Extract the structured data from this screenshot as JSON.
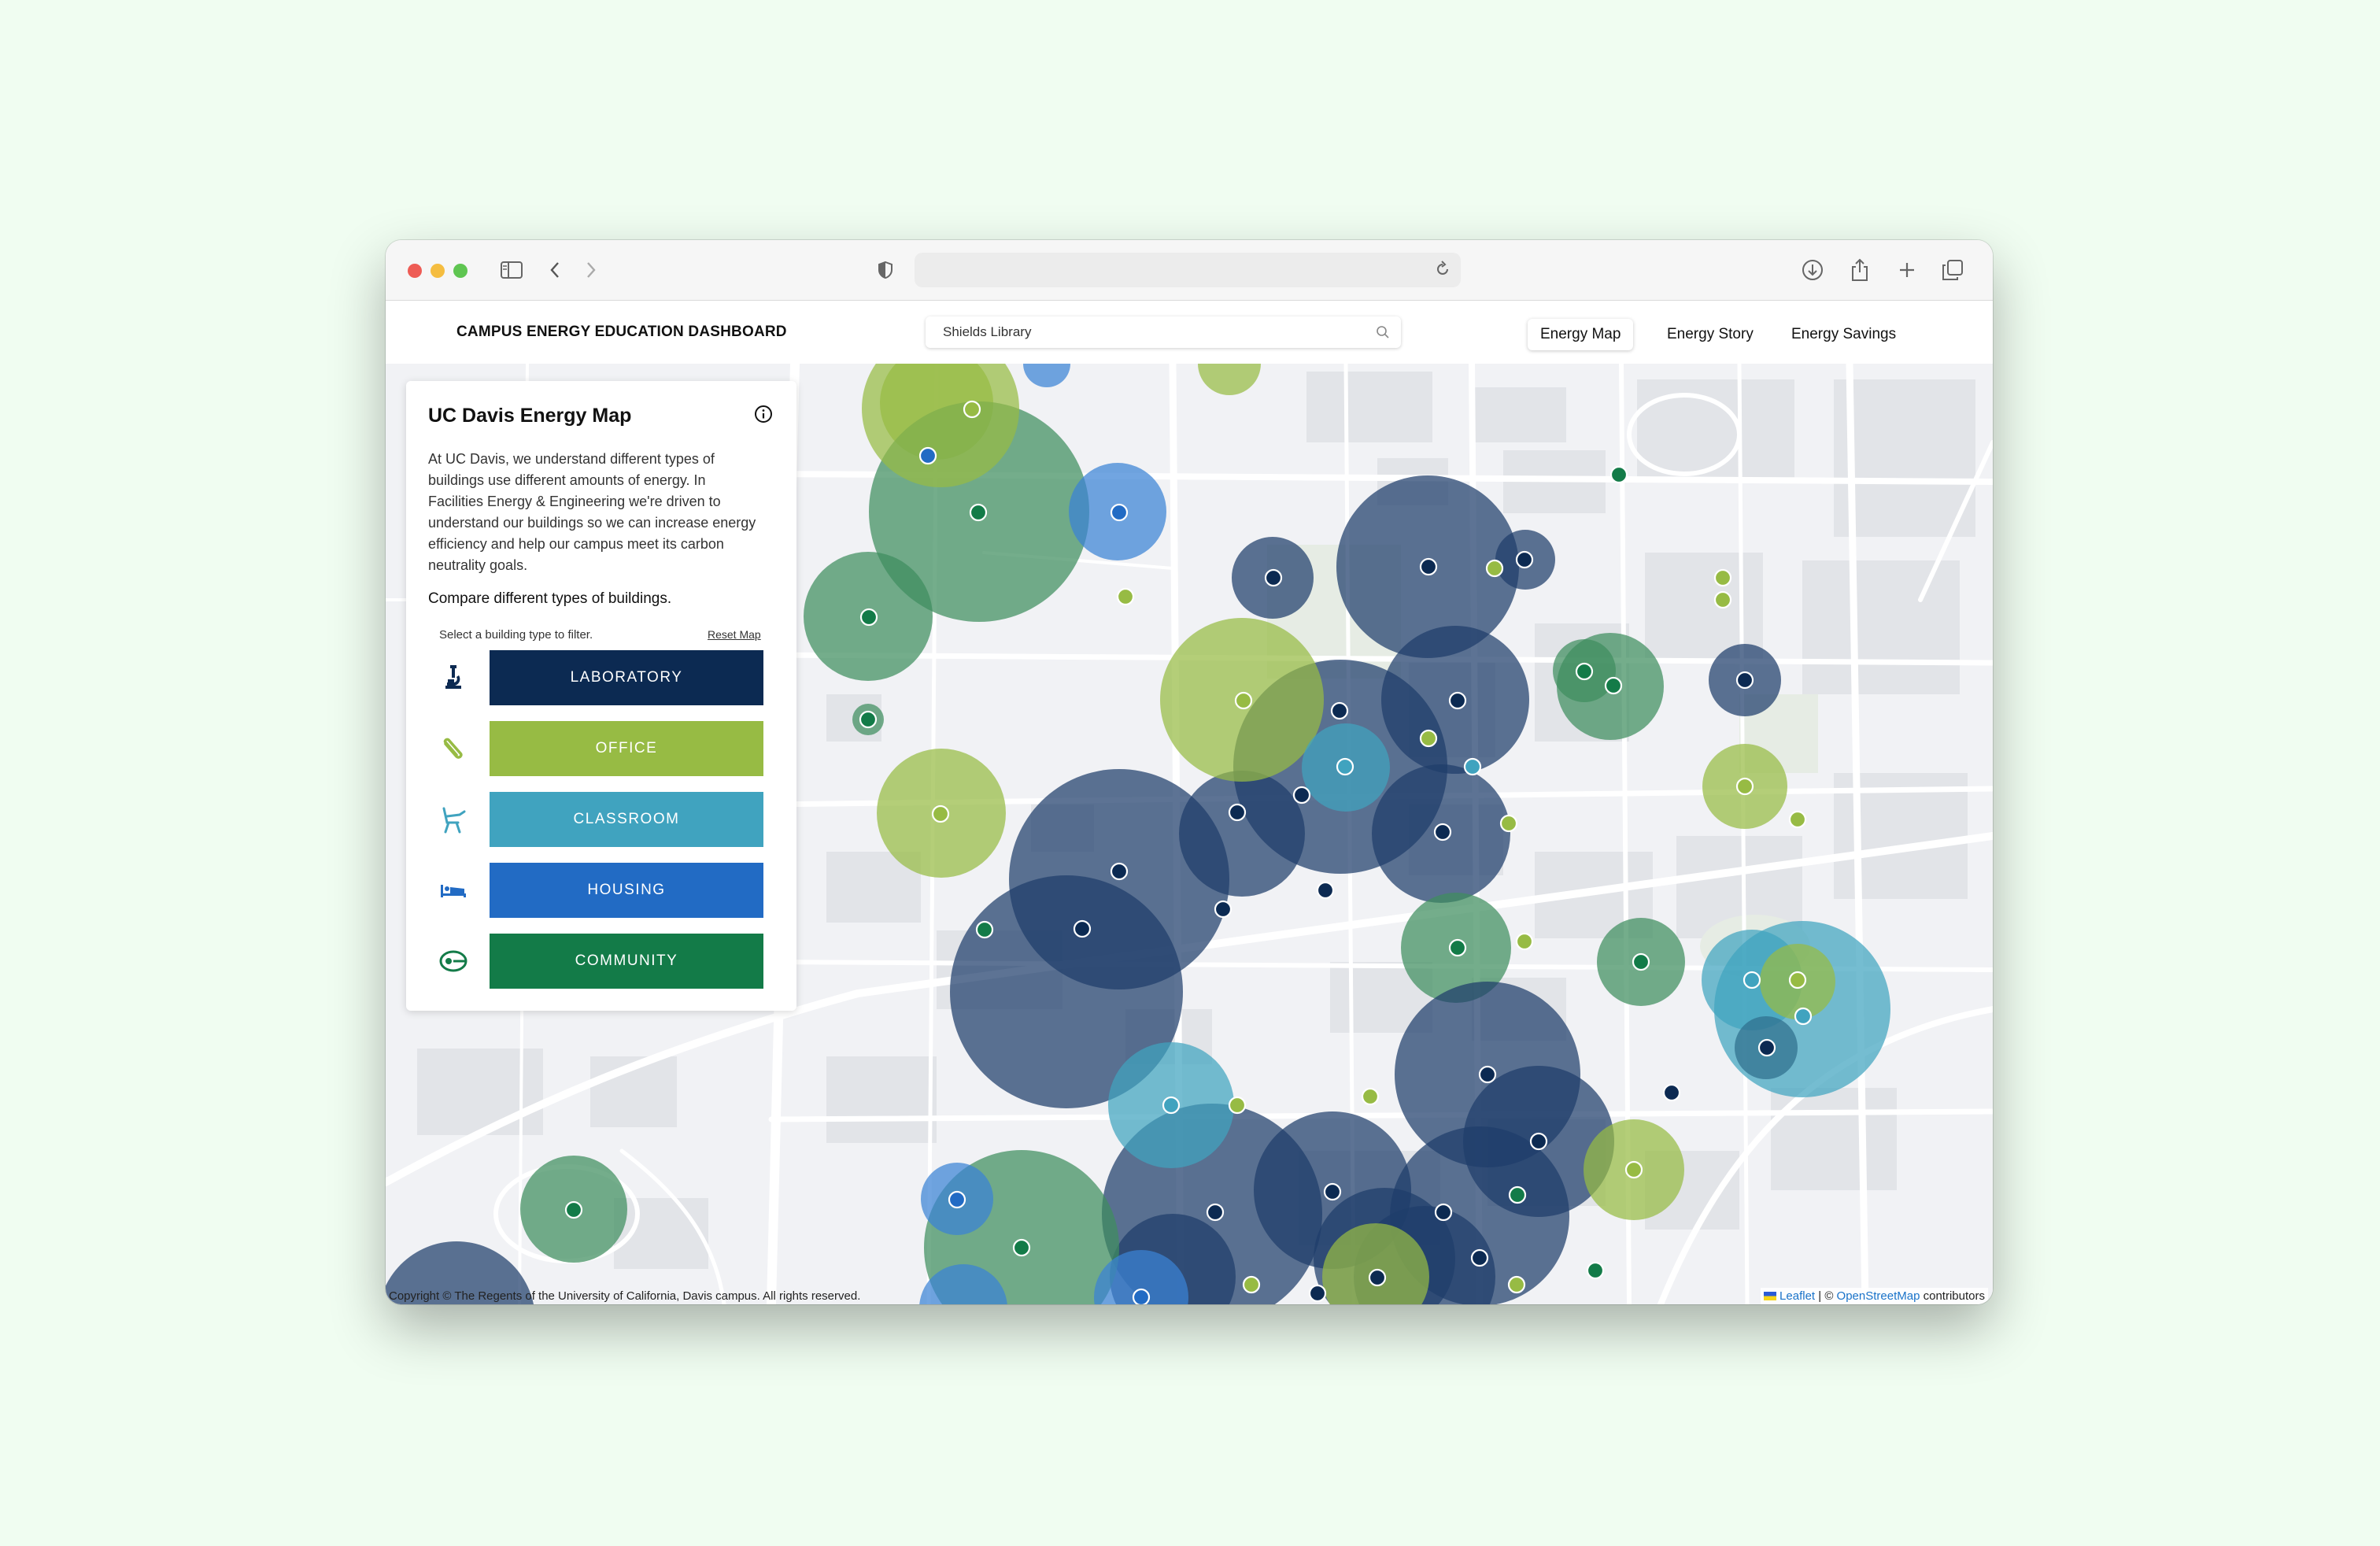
{
  "browser": {
    "address_text": "",
    "traffic_lights": [
      "#ee5c55",
      "#f5bd40",
      "#5fc551"
    ]
  },
  "app": {
    "title": "CAMPUS ENERGY EDUCATION DASHBOARD",
    "search_value": "Shields Library",
    "nav": [
      "Energy Map",
      "Energy Story",
      "Energy Savings"
    ],
    "active_nav": "Energy Map"
  },
  "panel": {
    "title": "UC Davis Energy Map",
    "description": "At UC Davis, we understand different types of buildings use different amounts of energy. In Facilities Energy & Engineering we're driven to understand our buildings so we can increase energy efficiency and help our campus meet its carbon neutrality goals.",
    "compare": "Compare different types of buildings.",
    "hint": "Select a building type to filter.",
    "reset": "Reset Map",
    "filters": [
      {
        "label": "LABORATORY",
        "color": "#0c2a52",
        "icon": "microscope-icon"
      },
      {
        "label": "OFFICE",
        "color": "#97bb44",
        "icon": "paperclip-icon"
      },
      {
        "label": "CLASSROOM",
        "color": "#40a3bf",
        "icon": "desk-chair-icon"
      },
      {
        "label": "HOUSING",
        "color": "#226bc4",
        "icon": "bed-icon"
      },
      {
        "label": "COMMUNITY",
        "color": "#137b48",
        "icon": "community-icon"
      }
    ]
  },
  "map": {
    "copyright": "Copyright © The Regents of the University of California, Davis campus. All rights reserved.",
    "attribution": {
      "leaflet": "Leaflet",
      "separator": " | © ",
      "osm": "OpenStreetMap",
      "suffix": " contributors"
    }
  }
}
